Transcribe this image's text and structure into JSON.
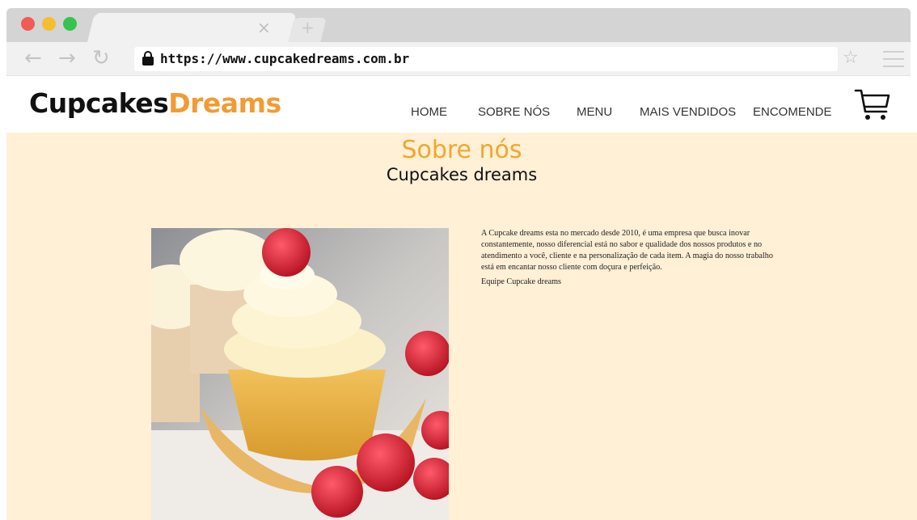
{
  "browser": {
    "url": "https://www.cupcakedreams.com.br",
    "tab_close": "×",
    "new_tab": "+",
    "icons": {
      "back": "arrow-left-icon",
      "forward": "arrow-right-icon",
      "reload": "reload-icon",
      "lock": "lock-icon",
      "bookmark": "star-icon",
      "menu": "hamburger-menu-icon"
    },
    "window_controls": {
      "close": "#f25a55",
      "minimize": "#f6bd2f",
      "maximize": "#36c34e"
    }
  },
  "site": {
    "logo": {
      "part1": "Cupcakes",
      "part2": "Dreams"
    },
    "nav": [
      "HOME",
      "SOBRE NÓS",
      "MENU",
      "MAIS VENDIDOS",
      "ENCOMENDE"
    ],
    "cart_icon": "shopping-cart-icon",
    "colors": {
      "accent": "#f29b33",
      "background": "#fff0d6",
      "title_orange": "#f4a52c"
    }
  },
  "about": {
    "title": "Sobre nós",
    "subtitle": "Cupcakes dreams",
    "paragraph": "A Cupcake dreams esta no mercado desde 2010, é uma empresa que busca inovar constantemente, nosso diferencial está no sabor e qualidade dos nossos produtos e no atendimento a você, cliente e na personalização de cada item. A magia do nosso trabalho está em encantar nosso cliente com doçura e perfeição.",
    "signature": "Equipe Cupcake dreams",
    "image": "cupcake-with-raspberry-photo"
  }
}
